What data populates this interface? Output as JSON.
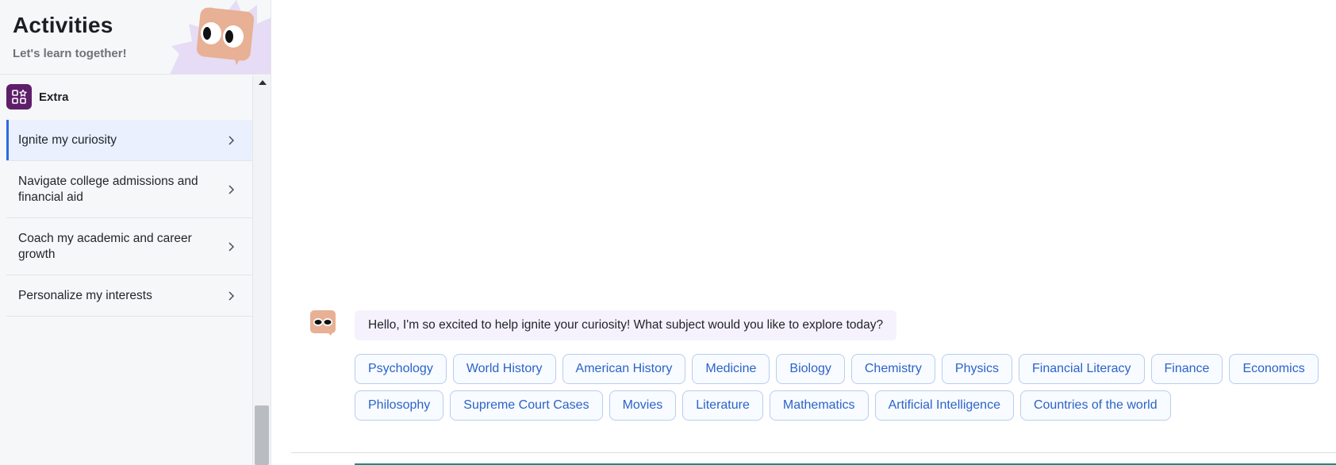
{
  "sidebar": {
    "title": "Activities",
    "subtitle": "Let's learn together!",
    "section": {
      "label": "Extra",
      "icon": "apps-star-icon"
    },
    "items": [
      {
        "label": "Ignite my curiosity",
        "active": true
      },
      {
        "label": "Navigate college admissions and financial aid",
        "active": false
      },
      {
        "label": "Coach my academic and career growth",
        "active": false
      },
      {
        "label": "Personalize my interests",
        "active": false
      }
    ]
  },
  "chat": {
    "bot_avatar": "mascot-icon",
    "message": "Hello, I'm so excited to help ignite your curiosity! What subject would you like to explore today?",
    "chips_row1": [
      "Psychology",
      "World History",
      "American History",
      "Medicine",
      "Biology",
      "Chemistry",
      "Physics",
      "Financial Literacy",
      "Finance",
      "Economics"
    ],
    "chips_row2": [
      "Philosophy",
      "Supreme Court Cases",
      "Movies",
      "Literature",
      "Mathematics",
      "Artificial Intelligence",
      "Countries of the world"
    ]
  },
  "colors": {
    "accent": "#2d6ae3",
    "section_icon_bg": "#5e1f6a",
    "chip_text": "#2b63c9",
    "bubble_bg": "#f6f2fd",
    "mascot": "#e8b094"
  }
}
